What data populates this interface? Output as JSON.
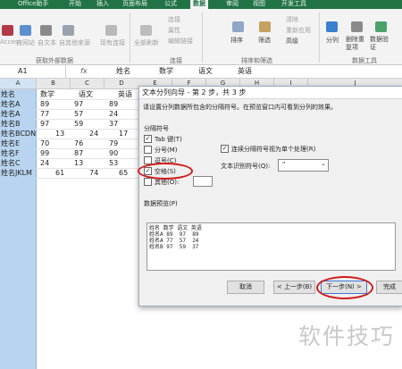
{
  "ribbon": {
    "tabs": [
      "Office助手",
      "开始",
      "插入",
      "页面布局",
      "公式",
      "数据",
      "审阅",
      "视图",
      "开发工具"
    ],
    "active_tab": "数据",
    "get_external": [
      "Access",
      "自网站",
      "自文本",
      "自其他来源",
      "现有连接"
    ],
    "refresh_all": "全部刷新",
    "connections": [
      "连接",
      "属性",
      "编辑链接"
    ],
    "sort_items": [
      "排序",
      "筛选"
    ],
    "filter_items": [
      "清除",
      "重新应用",
      "高级"
    ],
    "data_tools": [
      "分列",
      "删除重复项",
      "数据验证"
    ],
    "group_labels": [
      "获取外部数据",
      "连接",
      "排序和筛选",
      "数据工具"
    ]
  },
  "formula_bar": {
    "name_box": "A1",
    "fx": "fx",
    "content": [
      "姓名",
      "数学",
      "语文",
      "英语"
    ]
  },
  "columns": [
    "A",
    "B",
    "C",
    "D",
    "E",
    "F",
    "G",
    "H",
    "I",
    "J"
  ],
  "rows": [
    [
      "姓名",
      "数学",
      "语文",
      "英语"
    ],
    [
      "姓名A",
      "89",
      "97",
      "89"
    ],
    [
      "姓名A",
      "77",
      "57",
      "24"
    ],
    [
      "姓名B",
      "97",
      "59",
      "37"
    ],
    [
      "姓名BCDN",
      "13",
      "24",
      "17"
    ],
    [
      "姓名E",
      "70",
      "76",
      "79"
    ],
    [
      "姓名F",
      "99",
      "87",
      "90"
    ],
    [
      "姓名C",
      "24",
      "13",
      "53"
    ],
    [
      "姓名JKLM",
      "61",
      "74",
      "65"
    ]
  ],
  "dialog": {
    "title": "文本分列向导 - 第 2 步，共 3 步",
    "instruction": "请设置分列数据所包含的分隔符号。在预览窗口内可看到分列的效果。",
    "delimiters_label": "分隔符号",
    "delimiters": [
      {
        "label": "Tab 键(T)",
        "checked": true
      },
      {
        "label": "分号(M)",
        "checked": false
      },
      {
        "label": "逗号(C)",
        "checked": false
      },
      {
        "label": "空格(S)",
        "checked": true
      },
      {
        "label": "其他(O):",
        "checked": false
      }
    ],
    "consecutive_label": "连续分隔符号视为单个处理(R)",
    "consecutive_checked": true,
    "text_qualifier_label": "文本识别符号(Q):",
    "text_qualifier_value": "\"",
    "preview_label": "数据预览(P)",
    "preview_rows": [
      [
        "姓名",
        "数学",
        "语文",
        "英语"
      ],
      [
        "姓名A",
        "89",
        "97",
        "89"
      ],
      [
        "姓名A",
        "77",
        "57",
        "24"
      ],
      [
        "姓名B",
        "97",
        "59",
        "37"
      ]
    ],
    "buttons": {
      "cancel": "取消",
      "back": "< 上一步(B)",
      "next": "下一步(N) >",
      "finish": "完成"
    }
  },
  "watermark": "软件技巧"
}
